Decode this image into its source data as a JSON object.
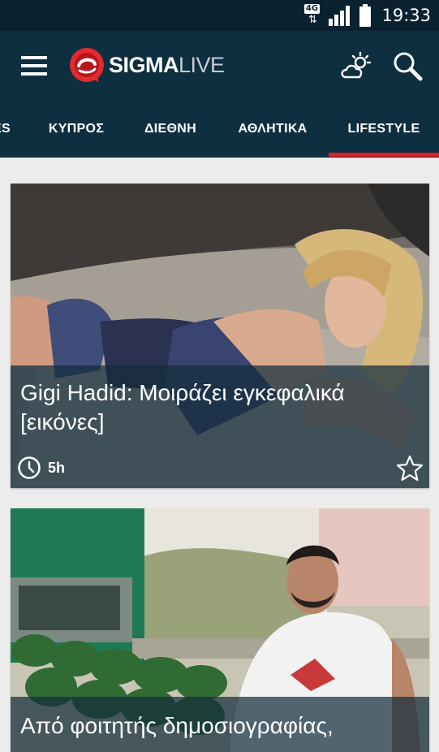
{
  "status_bar": {
    "network_badge": "4G",
    "network_arrows": "⇅",
    "time": "19:33"
  },
  "app_bar": {
    "logo_sigma": "SIGMA",
    "logo_live": "LIVE"
  },
  "tabs": [
    {
      "label": "ES"
    },
    {
      "label": "ΚΥΠΡΟΣ"
    },
    {
      "label": "ΔΙΕΘΝΗ"
    },
    {
      "label": "ΑΘΛΗΤΙΚΑ"
    },
    {
      "label": "LIFESTYLE",
      "active": true
    }
  ],
  "articles": [
    {
      "title": "Gigi Hadid: Μοιράζει εγκεφαλικά [εικόνες]",
      "time": "5h"
    },
    {
      "title": "Από φοιτητής δημοσιογραφίας,",
      "time": ""
    }
  ],
  "colors": {
    "header_bg": "#0d2f40",
    "status_bg": "#0a2230",
    "accent": "#d8222a",
    "page_bg": "#ececec"
  }
}
